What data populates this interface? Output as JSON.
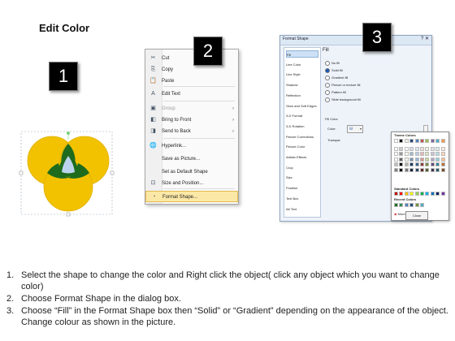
{
  "title": "Edit Color",
  "badges": [
    "1",
    "2",
    "3"
  ],
  "context_menu": {
    "items": [
      {
        "label": "Cut",
        "icon": "scissors-icon",
        "glyph": "✂",
        "disabled": false,
        "submenu": false
      },
      {
        "label": "Copy",
        "icon": "copy-icon",
        "glyph": "⎘",
        "disabled": false,
        "submenu": false
      },
      {
        "label": "Paste",
        "icon": "paste-icon",
        "glyph": "📋",
        "disabled": false,
        "submenu": false
      },
      {
        "label": "Edit Text",
        "icon": "edit-text-icon",
        "glyph": "A",
        "disabled": false,
        "submenu": false
      },
      {
        "label": "Group",
        "icon": "group-icon",
        "glyph": "▣",
        "disabled": true,
        "submenu": true
      },
      {
        "label": "Bring to Front",
        "icon": "bring-to-front-icon",
        "glyph": "◧",
        "disabled": false,
        "submenu": true
      },
      {
        "label": "Send to Back",
        "icon": "send-to-back-icon",
        "glyph": "◨",
        "disabled": false,
        "submenu": true
      },
      {
        "label": "Hyperlink...",
        "icon": "hyperlink-icon",
        "glyph": "🌐",
        "disabled": false,
        "submenu": false
      },
      {
        "label": "Save as Picture...",
        "icon": "",
        "glyph": "",
        "disabled": false,
        "submenu": false
      },
      {
        "label": "Set as Default Shape",
        "icon": "",
        "glyph": "",
        "disabled": false,
        "submenu": false
      },
      {
        "label": "Size and Position...",
        "icon": "size-position-icon",
        "glyph": "⊡",
        "disabled": false,
        "submenu": false
      },
      {
        "label": "Format Shape...",
        "icon": "format-shape-icon",
        "glyph": "◔",
        "disabled": false,
        "submenu": false,
        "highlighted": true
      }
    ]
  },
  "dialog": {
    "title": "Format Shape",
    "close_glyph": "? ✕",
    "nav": [
      "Fill",
      "Line Color",
      "Line Style",
      "Shadow",
      "Reflection",
      "Glow and Soft Edges",
      "3-D Format",
      "3-D Rotation",
      "Picture Corrections",
      "Picture Color",
      "Artistic Effects",
      "Crop",
      "Size",
      "Position",
      "Text Box",
      "Alt Text"
    ],
    "pane_heading": "Fill",
    "fill_options": [
      {
        "label": "No fill",
        "selected": false
      },
      {
        "label": "Solid fill",
        "selected": true
      },
      {
        "label": "Gradient fill",
        "selected": false
      },
      {
        "label": "Picture or texture fill",
        "selected": false
      },
      {
        "label": "Pattern fill",
        "selected": false
      },
      {
        "label": "Slide background fill",
        "selected": false
      }
    ],
    "fill_color_label": "Fill Color",
    "color_label": "Color:",
    "transparency_label": "Transpar",
    "popup": {
      "theme_colors_label": "Theme Colors",
      "standard_colors_label": "Standard Colors",
      "recent_colors_label": "Recent Colors",
      "more_colors_label": "More Colors..."
    },
    "close_button": "Close"
  },
  "colors": {
    "venn_yellow": "#f2c200",
    "venn_green": "#1e6b1e",
    "venn_center": "#bcd4ee"
  },
  "steps": [
    {
      "num": "1.",
      "text": "Select the shape to change the color and Right click the object( click any object which you want to change color)"
    },
    {
      "num": "2.",
      "text": "Choose Format Shape in the dialog box."
    },
    {
      "num": "3.",
      "text": "Choose “Fill” in the Format Shape box then “Solid” or “Gradient” depending on the appearance of the object. Change colour as shown in the picture."
    }
  ]
}
